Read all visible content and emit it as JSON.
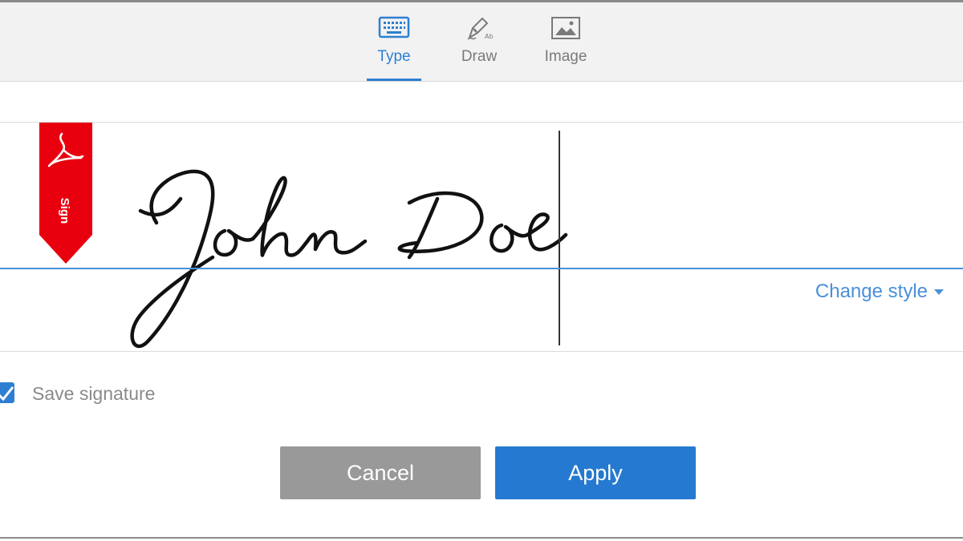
{
  "tabs": [
    {
      "id": "type",
      "label": "Type",
      "icon": "keyboard-icon",
      "active": true
    },
    {
      "id": "draw",
      "label": "Draw",
      "icon": "pen-icon",
      "active": false
    },
    {
      "id": "image",
      "label": "Image",
      "icon": "image-icon",
      "active": false
    }
  ],
  "ribbon": {
    "text": "Sign",
    "icon": "acrobat-logo-icon",
    "color": "#e8000f"
  },
  "signature": {
    "text": "John Doe"
  },
  "change_style": {
    "label": "Change style",
    "icon": "caret-down-icon"
  },
  "save_signature": {
    "label": "Save signature",
    "checked": true
  },
  "buttons": {
    "cancel": "Cancel",
    "apply": "Apply"
  },
  "colors": {
    "accent": "#2e7fd1",
    "cancel_bg": "#999999",
    "apply_bg": "#2579d0"
  }
}
